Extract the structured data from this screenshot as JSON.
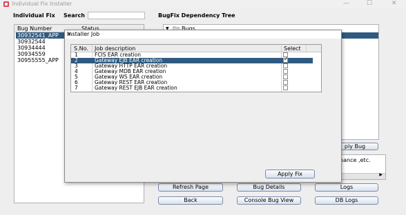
{
  "window": {
    "title": "Individual Fix  Installer",
    "min_glyph": "—",
    "max_glyph": "☐",
    "close_glyph": "✕"
  },
  "header": {
    "individual_fix": "Individual Fix",
    "search_label": "Search",
    "search_value": "",
    "tree_title": "BugFix Dependency Tree"
  },
  "bug_list": {
    "columns": [
      "Bug Number",
      "Status"
    ],
    "items": [
      "30932541_APP",
      "30932544",
      "30934444",
      "30934559",
      "30955555_APP"
    ],
    "selected_index": 0
  },
  "tree": {
    "root_label": "Bugs",
    "expand_glyph": "▼"
  },
  "right_panel": {
    "apply_bug_label": "ply Bug",
    "notes_text": "tenance ,etc."
  },
  "buttons": {
    "refresh": "Refresh Page",
    "bug_details": "Bug Details",
    "logs": "Logs",
    "back": "Back",
    "console_bug_view": "Console Bug View",
    "db_logs": "DB Logs"
  },
  "dialog": {
    "title": "Installer Job",
    "close_glyph": "✕",
    "columns": [
      "S.No.",
      "Job description",
      "Select"
    ],
    "rows": [
      {
        "sno": "1",
        "desc": "FCIS EAR creation",
        "checked": false
      },
      {
        "sno": "2",
        "desc": "Gateway EJB EAR creation",
        "checked": true
      },
      {
        "sno": "3",
        "desc": "Gateway HTTP EAR creation",
        "checked": false
      },
      {
        "sno": "4",
        "desc": "Gateway MDB EAR creation",
        "checked": false
      },
      {
        "sno": "5",
        "desc": "Gateway WS EAR creation",
        "checked": false
      },
      {
        "sno": "6",
        "desc": "Gateway REST EAR creation",
        "checked": false
      },
      {
        "sno": "7",
        "desc": "Gateway REST EJB EAR creation",
        "checked": false
      }
    ],
    "selected_index": 1,
    "apply_fix_label": "Apply Fix"
  }
}
